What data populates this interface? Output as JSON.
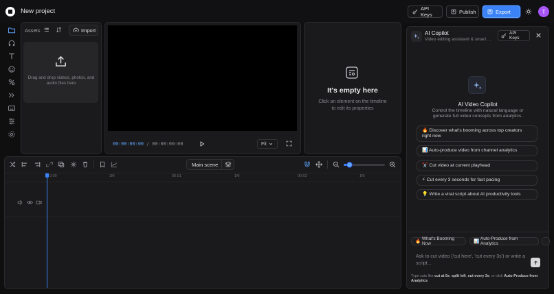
{
  "header": {
    "project_title": "New project",
    "api_keys_label": "API Keys",
    "publish_label": "Publish",
    "export_label": "Export",
    "avatar_initial": "T",
    "accent": "#3b82f6"
  },
  "assets": {
    "label": "Assets",
    "import_label": "Import",
    "drop_text": "Drag and drop videos, photos, and audio files here"
  },
  "preview": {
    "current_time": "00:00:00:00",
    "separator": "/",
    "duration": "00:00:00:00",
    "fit_label": "Fit"
  },
  "properties": {
    "empty_title": "It's empty here",
    "empty_subtitle": "Click an element on the timeline to edit its properties"
  },
  "timeline": {
    "scene_label": "Main scene",
    "ruler_labels": [
      "0:00",
      "1M",
      "00:01",
      "1M",
      "00:02",
      "1M"
    ],
    "zoom_level": 0.14
  },
  "copilot": {
    "title": "AI Copilot",
    "subtitle": "Video editing assistant & smart ...",
    "api_keys_label": "API Keys",
    "hero_title": "AI Video Copilot",
    "hero_subtitle": "Control the timeline with natural language or generate full video concepts from analytics.",
    "suggestions": [
      {
        "emoji": "🔥",
        "text": "Discover what's booming across top creators right now"
      },
      {
        "emoji": "📊",
        "text": "Auto-produce video from channel analytics"
      },
      {
        "emoji": "✂️",
        "text": "Cut video at current playhead"
      },
      {
        "emoji": "⚡",
        "text": "Cut every 3 seconds for fast pacing"
      },
      {
        "emoji": "💡",
        "text": "Write a viral script about AI productivity tools"
      }
    ],
    "chips": [
      {
        "emoji": "🔥",
        "text": "What's Booming Now"
      },
      {
        "emoji": "📊",
        "text": "Auto-Produce from Analytics"
      }
    ],
    "input_placeholder": "Ask to cut video ('cut here', 'cut every 3s') or write a script...",
    "footer": {
      "p1": "Type cuts like ",
      "b1": "cut at 5s",
      "p2": ", ",
      "b2": "split left",
      "p3": ", ",
      "b3": "cut every 3s",
      "p4": ", or click ",
      "b4": "Auto-Produce from Analytics",
      "p5": "."
    }
  }
}
